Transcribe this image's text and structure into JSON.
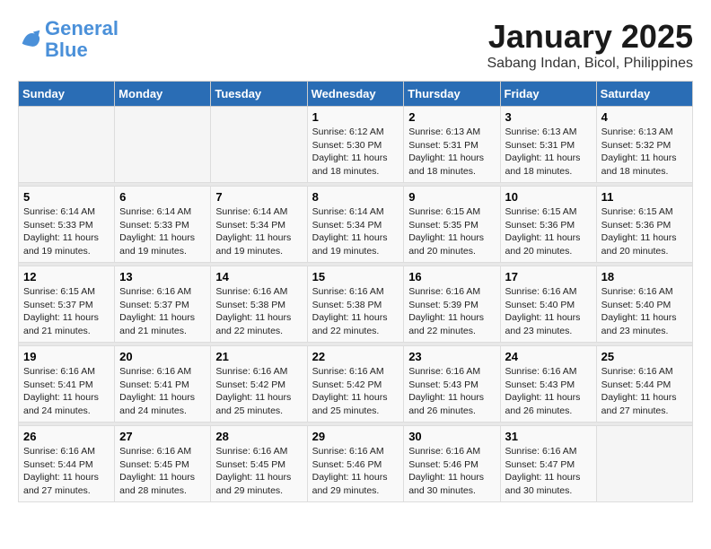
{
  "header": {
    "logo_line1": "General",
    "logo_line2": "Blue",
    "title": "January 2025",
    "subtitle": "Sabang Indan, Bicol, Philippines"
  },
  "days_of_week": [
    "Sunday",
    "Monday",
    "Tuesday",
    "Wednesday",
    "Thursday",
    "Friday",
    "Saturday"
  ],
  "weeks": [
    [
      {
        "day": "",
        "sunrise": "",
        "sunset": "",
        "daylight": ""
      },
      {
        "day": "",
        "sunrise": "",
        "sunset": "",
        "daylight": ""
      },
      {
        "day": "",
        "sunrise": "",
        "sunset": "",
        "daylight": ""
      },
      {
        "day": "1",
        "sunrise": "6:12 AM",
        "sunset": "5:30 PM",
        "daylight": "11 hours and 18 minutes."
      },
      {
        "day": "2",
        "sunrise": "6:13 AM",
        "sunset": "5:31 PM",
        "daylight": "11 hours and 18 minutes."
      },
      {
        "day": "3",
        "sunrise": "6:13 AM",
        "sunset": "5:31 PM",
        "daylight": "11 hours and 18 minutes."
      },
      {
        "day": "4",
        "sunrise": "6:13 AM",
        "sunset": "5:32 PM",
        "daylight": "11 hours and 18 minutes."
      }
    ],
    [
      {
        "day": "5",
        "sunrise": "6:14 AM",
        "sunset": "5:33 PM",
        "daylight": "11 hours and 19 minutes."
      },
      {
        "day": "6",
        "sunrise": "6:14 AM",
        "sunset": "5:33 PM",
        "daylight": "11 hours and 19 minutes."
      },
      {
        "day": "7",
        "sunrise": "6:14 AM",
        "sunset": "5:34 PM",
        "daylight": "11 hours and 19 minutes."
      },
      {
        "day": "8",
        "sunrise": "6:14 AM",
        "sunset": "5:34 PM",
        "daylight": "11 hours and 19 minutes."
      },
      {
        "day": "9",
        "sunrise": "6:15 AM",
        "sunset": "5:35 PM",
        "daylight": "11 hours and 20 minutes."
      },
      {
        "day": "10",
        "sunrise": "6:15 AM",
        "sunset": "5:36 PM",
        "daylight": "11 hours and 20 minutes."
      },
      {
        "day": "11",
        "sunrise": "6:15 AM",
        "sunset": "5:36 PM",
        "daylight": "11 hours and 20 minutes."
      }
    ],
    [
      {
        "day": "12",
        "sunrise": "6:15 AM",
        "sunset": "5:37 PM",
        "daylight": "11 hours and 21 minutes."
      },
      {
        "day": "13",
        "sunrise": "6:16 AM",
        "sunset": "5:37 PM",
        "daylight": "11 hours and 21 minutes."
      },
      {
        "day": "14",
        "sunrise": "6:16 AM",
        "sunset": "5:38 PM",
        "daylight": "11 hours and 22 minutes."
      },
      {
        "day": "15",
        "sunrise": "6:16 AM",
        "sunset": "5:38 PM",
        "daylight": "11 hours and 22 minutes."
      },
      {
        "day": "16",
        "sunrise": "6:16 AM",
        "sunset": "5:39 PM",
        "daylight": "11 hours and 22 minutes."
      },
      {
        "day": "17",
        "sunrise": "6:16 AM",
        "sunset": "5:40 PM",
        "daylight": "11 hours and 23 minutes."
      },
      {
        "day": "18",
        "sunrise": "6:16 AM",
        "sunset": "5:40 PM",
        "daylight": "11 hours and 23 minutes."
      }
    ],
    [
      {
        "day": "19",
        "sunrise": "6:16 AM",
        "sunset": "5:41 PM",
        "daylight": "11 hours and 24 minutes."
      },
      {
        "day": "20",
        "sunrise": "6:16 AM",
        "sunset": "5:41 PM",
        "daylight": "11 hours and 24 minutes."
      },
      {
        "day": "21",
        "sunrise": "6:16 AM",
        "sunset": "5:42 PM",
        "daylight": "11 hours and 25 minutes."
      },
      {
        "day": "22",
        "sunrise": "6:16 AM",
        "sunset": "5:42 PM",
        "daylight": "11 hours and 25 minutes."
      },
      {
        "day": "23",
        "sunrise": "6:16 AM",
        "sunset": "5:43 PM",
        "daylight": "11 hours and 26 minutes."
      },
      {
        "day": "24",
        "sunrise": "6:16 AM",
        "sunset": "5:43 PM",
        "daylight": "11 hours and 26 minutes."
      },
      {
        "day": "25",
        "sunrise": "6:16 AM",
        "sunset": "5:44 PM",
        "daylight": "11 hours and 27 minutes."
      }
    ],
    [
      {
        "day": "26",
        "sunrise": "6:16 AM",
        "sunset": "5:44 PM",
        "daylight": "11 hours and 27 minutes."
      },
      {
        "day": "27",
        "sunrise": "6:16 AM",
        "sunset": "5:45 PM",
        "daylight": "11 hours and 28 minutes."
      },
      {
        "day": "28",
        "sunrise": "6:16 AM",
        "sunset": "5:45 PM",
        "daylight": "11 hours and 29 minutes."
      },
      {
        "day": "29",
        "sunrise": "6:16 AM",
        "sunset": "5:46 PM",
        "daylight": "11 hours and 29 minutes."
      },
      {
        "day": "30",
        "sunrise": "6:16 AM",
        "sunset": "5:46 PM",
        "daylight": "11 hours and 30 minutes."
      },
      {
        "day": "31",
        "sunrise": "6:16 AM",
        "sunset": "5:47 PM",
        "daylight": "11 hours and 30 minutes."
      },
      {
        "day": "",
        "sunrise": "",
        "sunset": "",
        "daylight": ""
      }
    ]
  ],
  "labels": {
    "sunrise": "Sunrise:",
    "sunset": "Sunset:",
    "daylight": "Daylight:"
  }
}
